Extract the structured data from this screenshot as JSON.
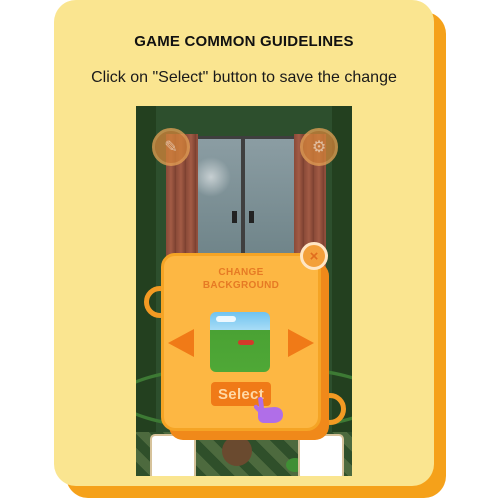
{
  "guide": {
    "title": "GAME COMMON GUIDELINES",
    "instruction": "Click on \"Select\" button to save the change"
  },
  "game": {
    "dialog": {
      "title_line1": "CHANGE",
      "title_line2": "BACKGROUND",
      "close_icon": "close-x-icon",
      "prev_icon": "arrow-left-icon",
      "next_icon": "arrow-right-icon",
      "select_label": "Select"
    },
    "top_left_icon": "edit-icon",
    "top_right_icon": "gear-icon"
  },
  "colors": {
    "card": "#fae590",
    "card_shadow": "#f5a11a",
    "dialog": "#fdb743",
    "accent_orange": "#f07a17",
    "pointer_purple": "#b06ee8"
  }
}
